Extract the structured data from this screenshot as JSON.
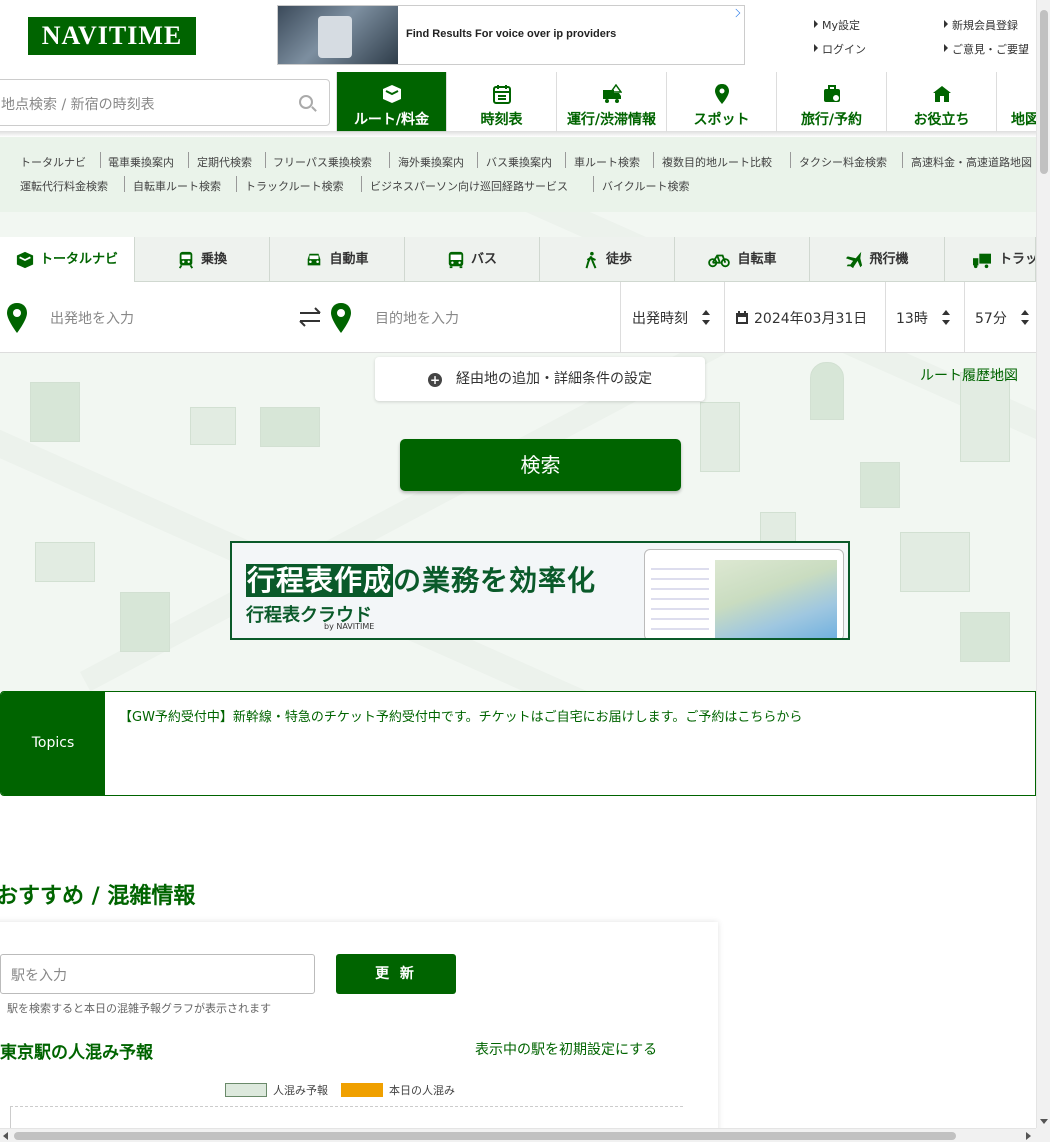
{
  "header": {
    "logo": "NAVITIME",
    "ad_text": "Find Results For voice over ip providers",
    "links": [
      "My設定",
      "新規会員登録",
      "ログイン",
      "ご意見・ご要望"
    ]
  },
  "search": {
    "placeholder": "地点検索 / 新宿の時刻表"
  },
  "nav": {
    "tabs": [
      {
        "label": "ルート/料金",
        "icon": "route-box-icon",
        "active": true
      },
      {
        "label": "時刻表",
        "icon": "timetable-icon"
      },
      {
        "label": "運行/渋滞情報",
        "icon": "traffic-icon"
      },
      {
        "label": "スポット",
        "icon": "location-pin-icon"
      },
      {
        "label": "旅行/予約",
        "icon": "luggage-icon"
      },
      {
        "label": "お役立ち",
        "icon": "house-icon"
      },
      {
        "label": "地図",
        "icon": "map-icon"
      }
    ]
  },
  "sublinks": {
    "row1": [
      "トータルナビ",
      "電車乗換案内",
      "定期代検索",
      "フリーパス乗換検索",
      "海外乗換案内",
      "バス乗換案内",
      "車ルート検索",
      "複数目的地ルート比較",
      "タクシー料金検索",
      "高速料金・高速道路地図"
    ],
    "row2": [
      "運転代行料金検索",
      "自転車ルート検索",
      "トラックルート検索",
      "ビジネスパーソン向け巡回経路サービス",
      "バイクルート検索"
    ]
  },
  "modes": [
    {
      "label": "トータルナビ",
      "icon": "box-icon",
      "active": true
    },
    {
      "label": "乗換",
      "icon": "train-icon"
    },
    {
      "label": "自動車",
      "icon": "car-icon"
    },
    {
      "label": "バス",
      "icon": "bus-icon"
    },
    {
      "label": "徒歩",
      "icon": "walk-icon"
    },
    {
      "label": "自転車",
      "icon": "bicycle-icon"
    },
    {
      "label": "飛行機",
      "icon": "airplane-icon"
    },
    {
      "label": "トラック",
      "icon": "truck-icon"
    }
  ],
  "form": {
    "from_placeholder": "出発地を入力",
    "to_placeholder": "目的地を入力",
    "time_type": "出発時刻",
    "date": "2024年03月31日",
    "hour": "13時",
    "minute": "57分",
    "detail": "経由地の追加・詳細条件の設定",
    "history_map": "ルート履歴地図",
    "search_button": "検索"
  },
  "banner": {
    "highlight": "行程表作成",
    "headline_rest": "の業務を効率化",
    "product": "行程表クラウド",
    "by": "by NAVITIME"
  },
  "topics": {
    "label": "Topics",
    "text": "【GW予約受付中】新幹線・特急のチケット予約受付中です。チケットはご自宅にお届けします。ご予約はこちらから"
  },
  "recommend": {
    "title": "おすすめ / 混雑情報",
    "station_placeholder": "駅を入力",
    "update_button": "更 新",
    "hint": "駅を検索すると本日の混雑予報グラフが表示されます",
    "crowd_title": "東京駅の人混み予報",
    "reset_link": "表示中の駅を初期設定にする",
    "legend": [
      {
        "label": "人混み予報",
        "color": "#dde9dd"
      },
      {
        "label": "本日の人混み",
        "color": "#f0a000"
      }
    ]
  },
  "colors": {
    "brand": "#006400",
    "accent_orange": "#f0a000"
  }
}
